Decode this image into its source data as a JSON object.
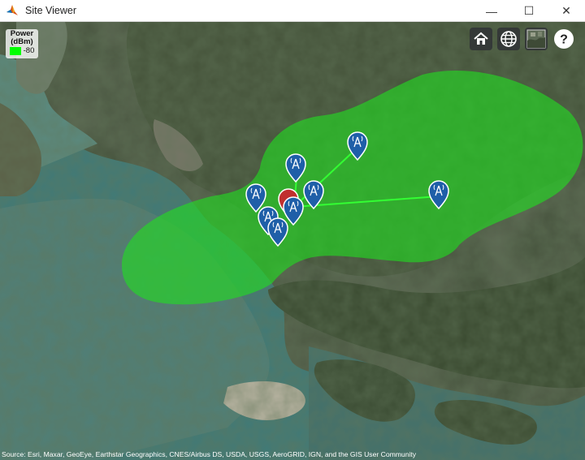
{
  "window": {
    "title": "Site Viewer",
    "controls": {
      "minimize": "—",
      "maximize": "☐",
      "close": "✕"
    }
  },
  "legend": {
    "title_line1": "Power",
    "title_line2": "(dBm)",
    "value": "-80",
    "color": "#00ff00"
  },
  "toolbar": {
    "home_icon": "home-icon",
    "basemap_icon": "globe-icon",
    "imagery_icon": "basemap-thumbnail-icon",
    "help_label": "?"
  },
  "attribution": "Source: Esri, Maxar, GeoEye, Earthstar Geographics, CNES/Airbus DS, USDA, USGS, AeroGRID, IGN, and the GIS User Community",
  "colors": {
    "coverage": "#22dd22",
    "site_marker": "#1f5fa8",
    "link_line": "#33ff33",
    "selected_marker": "#c0302f"
  }
}
